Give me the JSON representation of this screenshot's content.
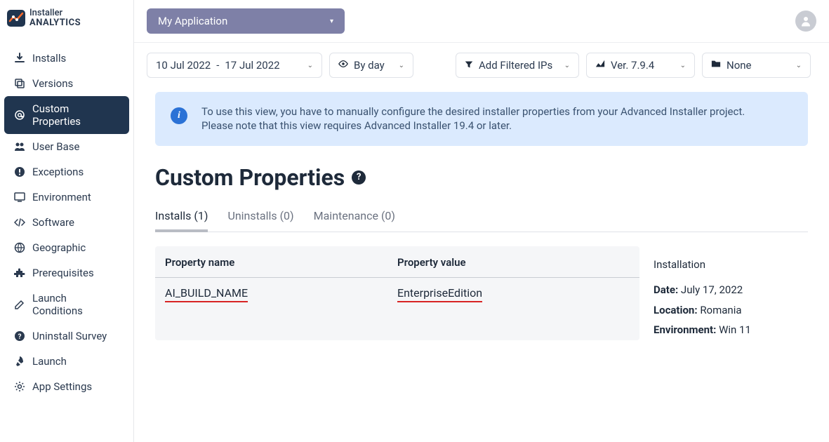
{
  "brand": {
    "line1": "Installer",
    "line2": "ANALYTICS"
  },
  "app_selector": {
    "label": "My Application"
  },
  "sidebar": {
    "items": [
      {
        "label": "Installs",
        "icon": "download-icon"
      },
      {
        "label": "Versions",
        "icon": "copy-icon"
      },
      {
        "label": "Custom Properties",
        "icon": "at-icon",
        "active": true
      },
      {
        "label": "User Base",
        "icon": "users-icon"
      },
      {
        "label": "Exceptions",
        "icon": "error-icon"
      },
      {
        "label": "Environment",
        "icon": "monitor-icon"
      },
      {
        "label": "Software",
        "icon": "code-icon"
      },
      {
        "label": "Geographic",
        "icon": "globe-icon"
      },
      {
        "label": "Prerequisites",
        "icon": "puzzle-icon"
      },
      {
        "label": "Launch Conditions",
        "icon": "edit-icon"
      },
      {
        "label": "Uninstall Survey",
        "icon": "survey-icon"
      },
      {
        "label": "Launch",
        "icon": "rocket-icon"
      },
      {
        "label": "App Settings",
        "icon": "gear-icon"
      }
    ]
  },
  "filters": {
    "date_from": "10 Jul 2022",
    "date_to": "17 Jul 2022",
    "granularity": "By day",
    "filtered_ips": "Add Filtered IPs",
    "version": "Ver. 7.9.4",
    "folder": "None"
  },
  "info": {
    "line1": "To use this view, you have to manually configure the desired installer properties from your Advanced Installer project.",
    "line2": "Please note that this view requires Advanced Installer 19.4 or later."
  },
  "page": {
    "title": "Custom Properties"
  },
  "tabs": [
    {
      "label": "Installs (1)",
      "active": true
    },
    {
      "label": "Uninstalls (0)"
    },
    {
      "label": "Maintenance (0)"
    }
  ],
  "table": {
    "headers": {
      "name": "Property name",
      "value": "Property value"
    },
    "rows": [
      {
        "name": "AI_BUILD_NAME",
        "value": "EnterpriseEdition"
      }
    ]
  },
  "install_info": {
    "title": "Installation",
    "date_label": "Date:",
    "date_value": "July 17, 2022",
    "location_label": "Location:",
    "location_value": "Romania",
    "env_label": "Environment:",
    "env_value": "Win 11"
  }
}
